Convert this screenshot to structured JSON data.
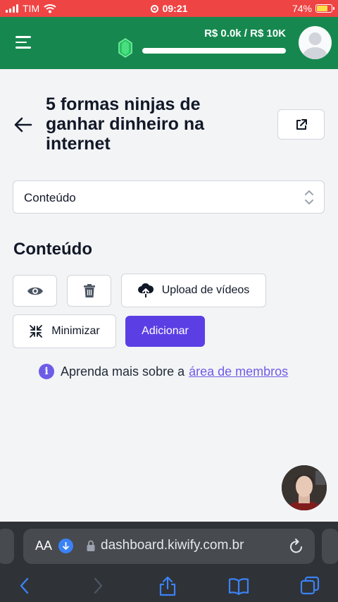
{
  "status_bar": {
    "carrier": "TIM",
    "time": "09:21",
    "battery": "74%"
  },
  "header": {
    "goal_text": "R$ 0.0k / R$ 10K",
    "progress": 0
  },
  "page": {
    "title": "5 formas ninjas de ganhar dinheiro na internet",
    "select_value": "Conteúdo",
    "section_title": "Conteúdo"
  },
  "actions": {
    "upload_label": "Upload de vídeos",
    "minimize_label": "Minimizar",
    "add_label": "Adicionar"
  },
  "info": {
    "text": "Aprenda mais sobre a",
    "link": "área de membros"
  },
  "browser": {
    "text_size_label": "AA",
    "url": "dashboard.kiwify.com.br"
  },
  "colors": {
    "brand_green": "#16884f",
    "accent_purple": "#5b3fe4",
    "status_red": "#ef4444"
  }
}
